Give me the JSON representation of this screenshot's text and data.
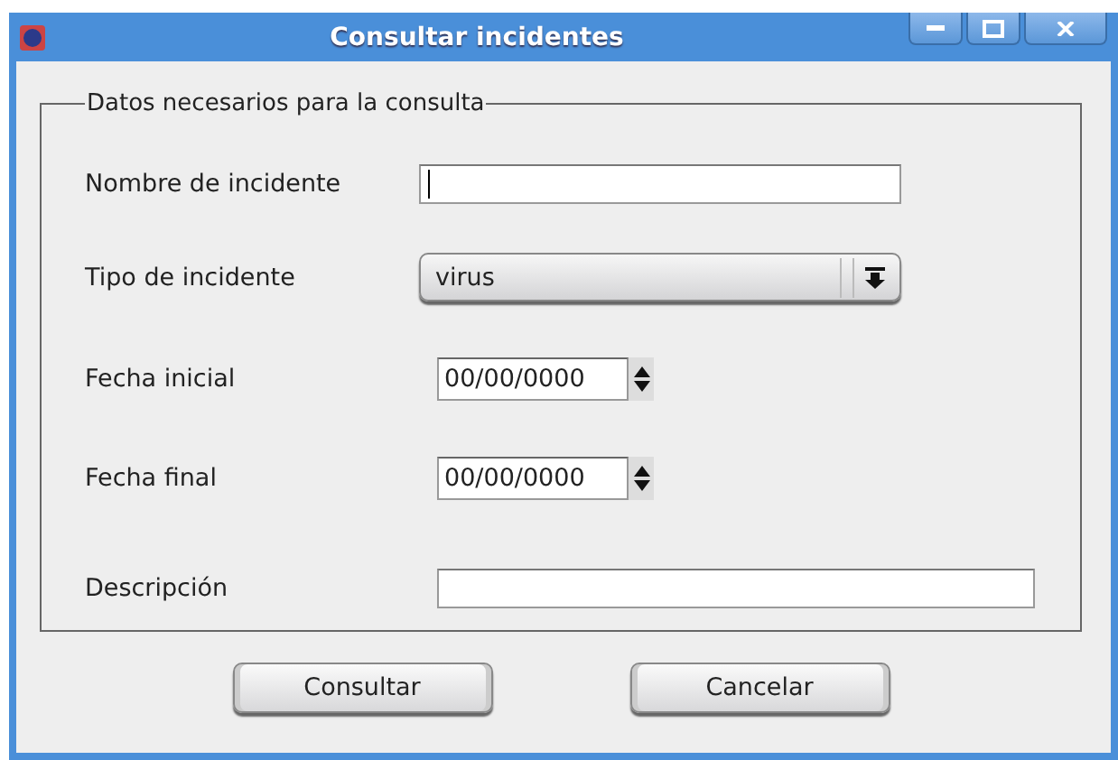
{
  "window": {
    "title": "Consultar incidentes"
  },
  "group": {
    "legend": "Datos necesarios para la consulta"
  },
  "fields": [
    {
      "kind": "text",
      "label": "Nombre de incidente",
      "focused": true
    },
    {
      "kind": "select",
      "label": "Tipo de incidente",
      "value": "virus"
    },
    {
      "kind": "date",
      "label": "Fecha inicial",
      "value": "00/00/0000"
    },
    {
      "kind": "date",
      "label": "Fecha final",
      "value": "00/00/0000"
    },
    {
      "kind": "longtext",
      "label": "Descripción"
    }
  ],
  "buttons": [
    "Consultar",
    "Cancelar"
  ]
}
